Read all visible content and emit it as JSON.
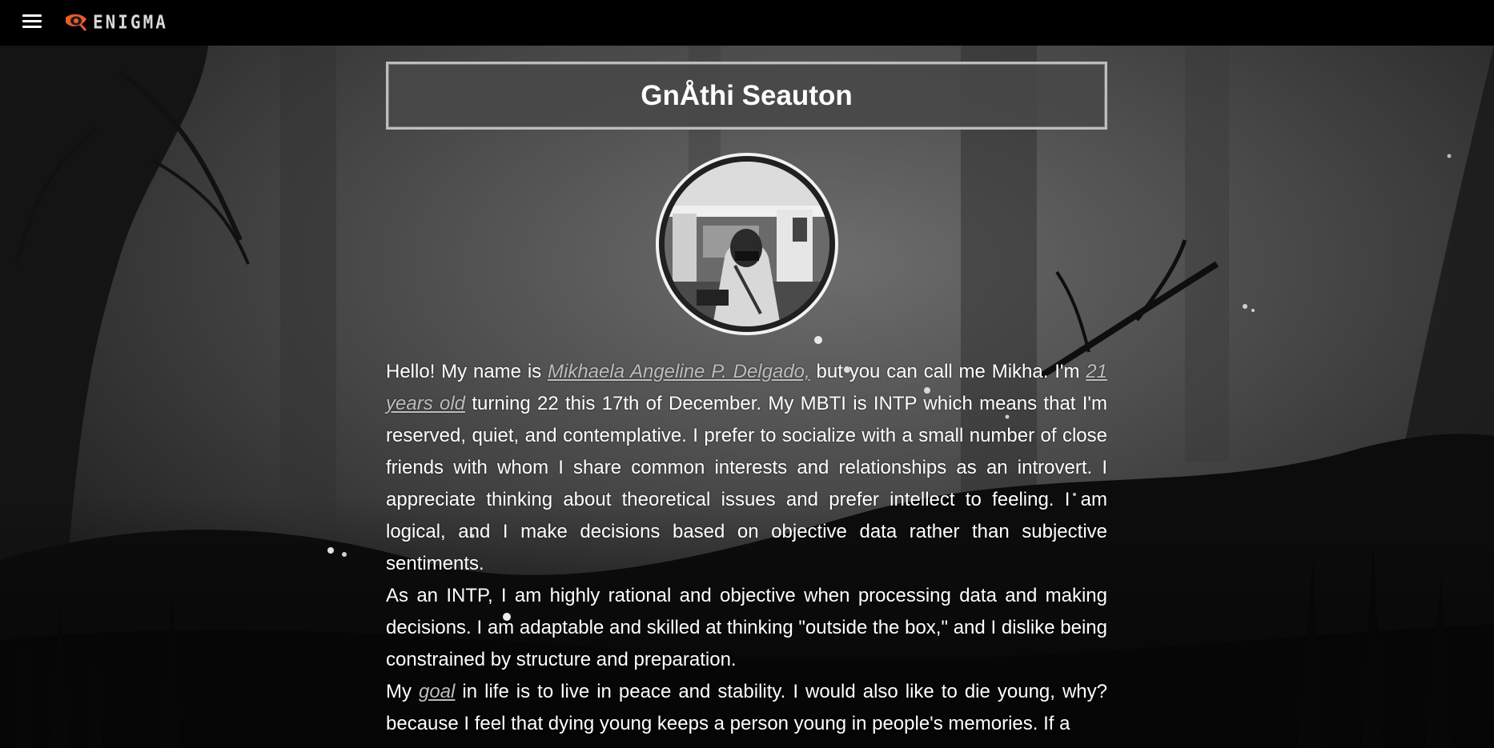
{
  "nav": {
    "menu_icon": "hamburger-menu-icon",
    "logo_icon": "eye-logo-icon",
    "logo_text": "ENIGMA"
  },
  "header": {
    "title": "GnÅthi Seauton"
  },
  "bio": {
    "p1": {
      "t1": "Hello! My name is ",
      "name_link": "Mikhaela Angeline P. Delgado,",
      "t2": " but you can call me Mikha. I'm ",
      "age_link": "21 years old",
      "t3": " turning 22 this 17th of December. My MBTI is INTP which means that I'm reserved, quiet, and contemplative. I prefer to socialize with a small number of close friends with whom I share common interests and relationships as an introvert. I appreciate thinking about theoretical issues and prefer intellect to feeling. I am logical, and I make decisions based on objective data rather than subjective sentiments."
    },
    "p2": "As an INTP, I am highly rational and objective when processing data and making decisions. I am adaptable and skilled at thinking \"outside the box,\" and I dislike being constrained by structure and preparation.",
    "p3": {
      "t1": "My ",
      "goal_link": "goal",
      "t2": " in life is to live in peace and stability. I would also like to die young, why? because I feel that dying young keeps a person young in people's memories. If a"
    }
  },
  "colors": {
    "navbar": "#000000",
    "title_box_bg": "#484848",
    "title_box_border": "#bdbdbd",
    "link": "#bdbdbd",
    "text": "#ffffff"
  }
}
